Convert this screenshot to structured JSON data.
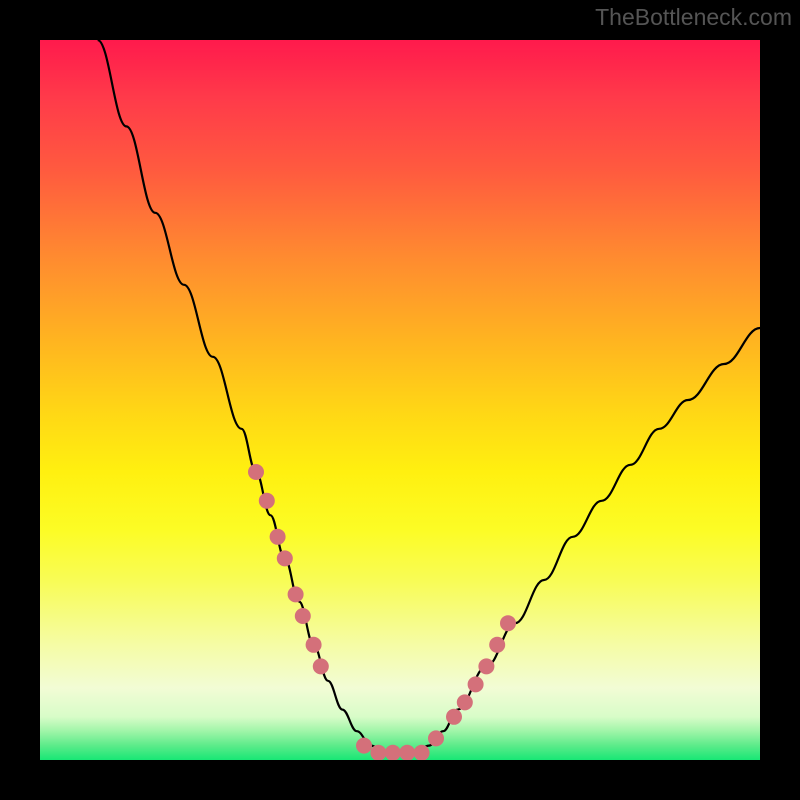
{
  "watermark": "TheBottleneck.com",
  "chart_data": {
    "type": "line",
    "title": "",
    "xlabel": "",
    "ylabel": "",
    "xlim": [
      0,
      100
    ],
    "ylim": [
      0,
      100
    ],
    "series": [
      {
        "name": "bottleneck-curve",
        "x": [
          8,
          12,
          16,
          20,
          24,
          28,
          30,
          32,
          34,
          36,
          38,
          40,
          42,
          44,
          46,
          48,
          50,
          52,
          54,
          56,
          58,
          62,
          66,
          70,
          74,
          78,
          82,
          86,
          90,
          95,
          100
        ],
        "y": [
          100,
          88,
          76,
          66,
          56,
          46,
          40,
          34,
          28,
          22,
          16,
          11,
          7,
          4,
          2,
          1,
          1,
          1,
          2,
          4,
          7,
          13,
          19,
          25,
          31,
          36,
          41,
          46,
          50,
          55,
          60
        ]
      }
    ],
    "markers": {
      "name": "highlight-points",
      "x": [
        30,
        31.5,
        33,
        34,
        35.5,
        36.5,
        38,
        39,
        45,
        47,
        49,
        51,
        53,
        55,
        57.5,
        59,
        60.5,
        62,
        63.5,
        65
      ],
      "y": [
        40,
        36,
        31,
        28,
        23,
        20,
        16,
        13,
        2,
        1,
        1,
        1,
        1,
        3,
        6,
        8,
        10.5,
        13,
        16,
        19
      ],
      "color": "#d4707a",
      "radius": 8
    },
    "gradient_stops": [
      {
        "pos": 0,
        "color": "#ff1a4c"
      },
      {
        "pos": 50,
        "color": "#ffe015"
      },
      {
        "pos": 85,
        "color": "#f8fcb0"
      },
      {
        "pos": 100,
        "color": "#18e775"
      }
    ]
  }
}
